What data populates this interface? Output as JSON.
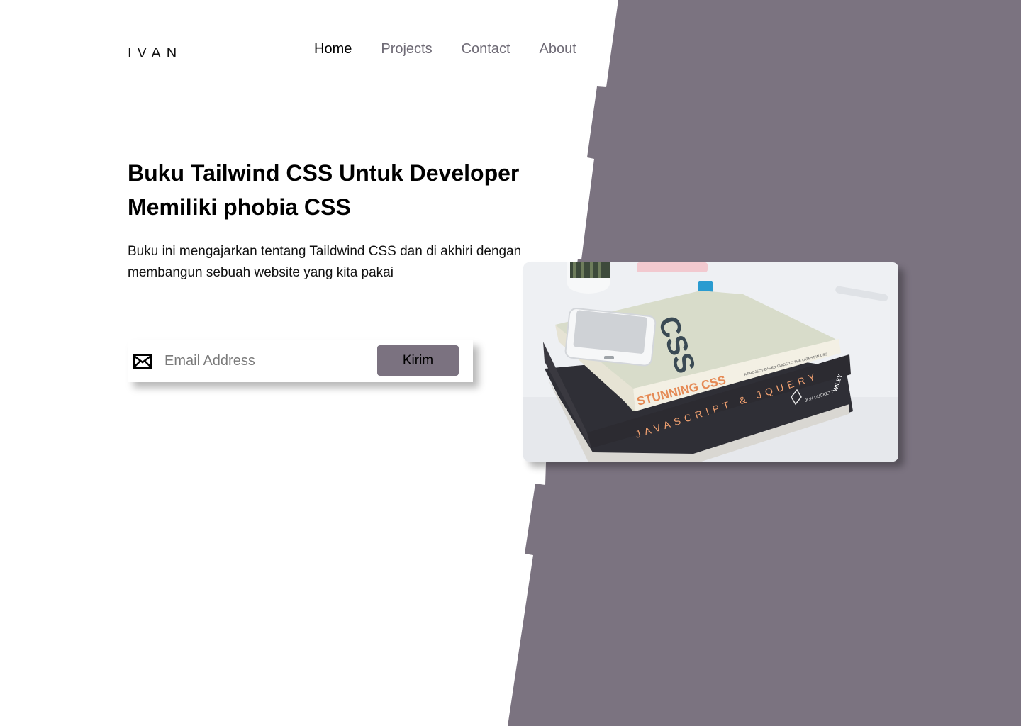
{
  "brand": {
    "logo": "IVAN"
  },
  "nav": {
    "items": [
      {
        "label": "Home",
        "active": true
      },
      {
        "label": "Projects",
        "active": false
      },
      {
        "label": "Contact",
        "active": false
      },
      {
        "label": "About",
        "active": false
      }
    ]
  },
  "hero": {
    "title": "Buku Tailwind CSS Untuk Developer Memiliki phobia CSS",
    "description": "Buku ini mengajarkan tentang Taildwind CSS dan di akhiri dengan membangun sebuah website yang kita pakai"
  },
  "form": {
    "email_placeholder": "Email Address",
    "email_value": "",
    "submit_label": "Kirim",
    "icon": "mail-icon"
  },
  "image": {
    "subject": "books-photo",
    "book_top_title": "STUNNING CSS",
    "book_bottom_title": "JAVASCRIPT & JQUERY",
    "book_bottom_author": "JON DUCKETT",
    "book_bottom_publisher": "WILEY"
  },
  "colors": {
    "accent": "#7b7280",
    "background": "#ffffff",
    "text": "#111111",
    "nav_inactive": "#6e6a75"
  }
}
